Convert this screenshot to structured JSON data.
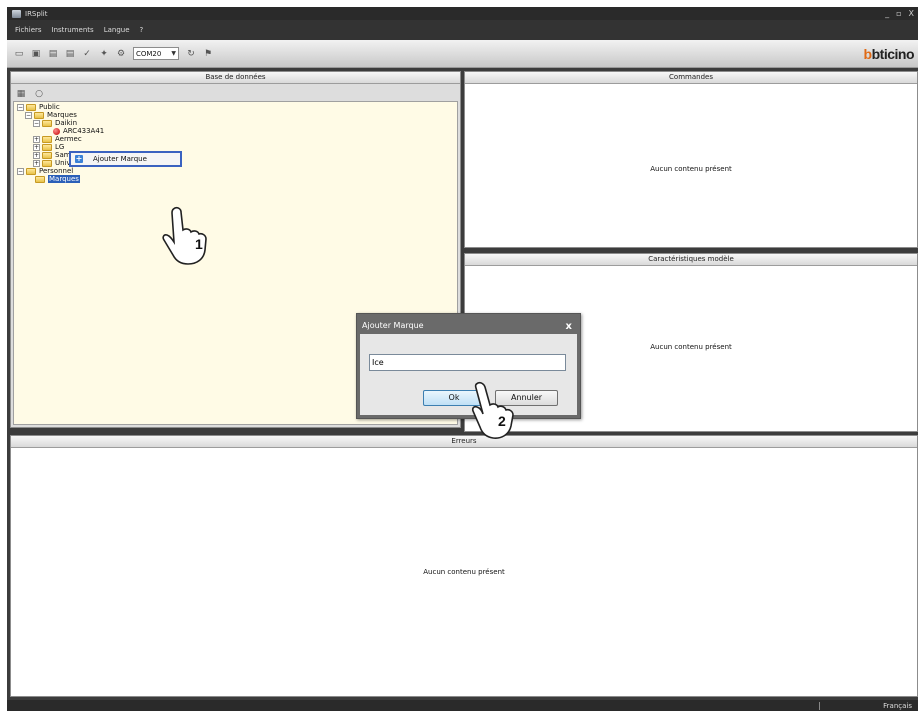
{
  "window": {
    "title": "IRSplit",
    "controls": [
      "_",
      "▫",
      "X"
    ]
  },
  "menu": [
    "Fichiers",
    "Instruments",
    "Langue",
    "?"
  ],
  "toolbar": {
    "com_port": "COM20",
    "logo_text": "bticino"
  },
  "panels": {
    "database": {
      "title": "Base de données"
    },
    "commands": {
      "title": "Commandes",
      "empty_text": "Aucun contenu présent"
    },
    "characteristics": {
      "title": "Caractéristiques modèle",
      "empty_text": "Aucun contenu présent"
    },
    "errors": {
      "title": "Erreurs",
      "empty_text": "Aucun contenu présent"
    }
  },
  "tree": {
    "public": "Public",
    "marques": "Marques",
    "daikin": "Daikin",
    "arc": "ARC433A41",
    "aermec": "Aermec",
    "lg": "LG",
    "samsung": "Samsung",
    "universal": "Universal",
    "personnel": "Personnel",
    "marques_personnel": "Marques"
  },
  "context_menu": {
    "item": "Ajouter Marque"
  },
  "dialog": {
    "title": "Ajouter Marque",
    "input_value": "Ice",
    "ok": "Ok",
    "cancel": "Annuler"
  },
  "callouts": {
    "one": "1",
    "two": "2"
  },
  "status": {
    "language": "Français"
  }
}
